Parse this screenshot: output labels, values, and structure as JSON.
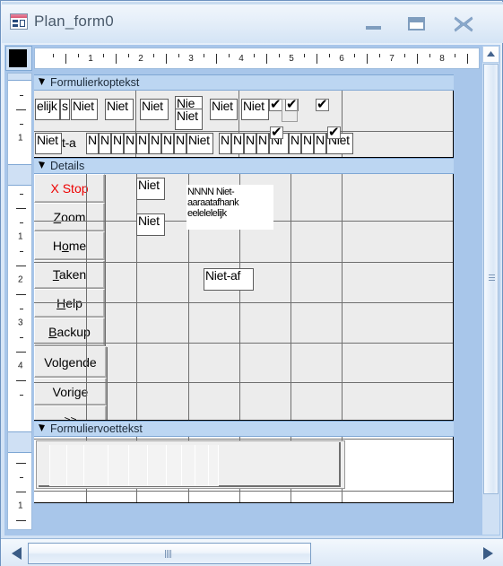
{
  "window": {
    "title": "Plan_form0",
    "icon": "access-form-icon",
    "buttons": {
      "minimize": "minimize-button",
      "maximize": "maximize-button",
      "close": "close-button"
    }
  },
  "rulers": {
    "horizontal_labels": [
      "1",
      "2",
      "3",
      "4",
      "5",
      "6",
      "7",
      "8"
    ],
    "vertical_labels": [
      "1",
      "1",
      "2",
      "3",
      "4"
    ],
    "unit": "inch",
    "select_all_box": "select-all-box"
  },
  "sections": [
    {
      "name": "form-header",
      "label": "Formulierkoptekst"
    },
    {
      "name": "detail",
      "label": "Details"
    },
    {
      "name": "form-footer",
      "label": "Formuliervoettekst"
    }
  ],
  "header_controls": {
    "row1": [
      {
        "type": "textbox",
        "value": "elijk"
      },
      {
        "type": "textbox",
        "value": "s"
      },
      {
        "type": "textbox",
        "value": "Niet"
      },
      {
        "type": "textbox",
        "value": "Niet"
      },
      {
        "type": "textbox",
        "value": "Niet"
      },
      {
        "type": "textbox",
        "value": "Nie"
      },
      {
        "type": "textbox",
        "value": "Niet"
      },
      {
        "type": "textbox",
        "value": "Niet"
      },
      {
        "type": "textbox",
        "value": "Niet"
      },
      {
        "type": "checkbox",
        "checked": true
      },
      {
        "type": "checkbox",
        "checked": true
      },
      {
        "type": "checkbox",
        "checked": true
      }
    ],
    "row2": [
      {
        "type": "textbox",
        "value": "Niet"
      },
      {
        "type": "textbox",
        "value": "t-a"
      },
      {
        "type": "textbox",
        "value": "N"
      },
      {
        "type": "textbox",
        "value": "N"
      },
      {
        "type": "textbox",
        "value": "N"
      },
      {
        "type": "textbox",
        "value": "N"
      },
      {
        "type": "textbox",
        "value": "N"
      },
      {
        "type": "textbox",
        "value": "N"
      },
      {
        "type": "textbox",
        "value": "N"
      },
      {
        "type": "textbox",
        "value": "N"
      },
      {
        "type": "textbox",
        "value": "Niet"
      },
      {
        "type": "textbox",
        "value": "N"
      },
      {
        "type": "textbox",
        "value": "N"
      },
      {
        "type": "textbox",
        "value": "N"
      },
      {
        "type": "textbox",
        "value": "N"
      },
      {
        "type": "textbox",
        "value": "Ni"
      },
      {
        "type": "textbox",
        "value": "N"
      },
      {
        "type": "textbox",
        "value": "N"
      },
      {
        "type": "textbox",
        "value": "N"
      },
      {
        "type": "textbox",
        "value": "Niet"
      },
      {
        "type": "checkbox",
        "checked": true
      },
      {
        "type": "checkbox",
        "checked": true
      }
    ]
  },
  "detail_controls": {
    "buttons_left": [
      {
        "name": "stop-button",
        "label": "X Stop",
        "accel": "",
        "style": "red"
      },
      {
        "name": "zoom-button",
        "label": "Zoom",
        "accel": "Z"
      },
      {
        "name": "home-button",
        "label": "Home",
        "accel": "o"
      },
      {
        "name": "taken-button",
        "label": "Taken",
        "accel": "T"
      },
      {
        "name": "help-button",
        "label": "Help",
        "accel": "H"
      },
      {
        "name": "backup-button",
        "label": "Backup",
        "accel": "B"
      }
    ],
    "buttons_mid": [
      {
        "name": "volgende-button",
        "label": "Volgende"
      },
      {
        "name": "vorige-button",
        "label": "Vorige"
      },
      {
        "name": "forward-button",
        "label": ">>"
      }
    ],
    "textboxes": [
      {
        "name": "detail-textbox-1",
        "value": "Niet"
      },
      {
        "name": "detail-textbox-2",
        "value": "Niet"
      },
      {
        "name": "detail-textbox-3",
        "value": "Niet-af"
      }
    ],
    "memo_label": {
      "name": "memo-label",
      "lines": [
        "NNNN Niet-",
        "aaraatafhank",
        "eelelelelijk"
      ]
    }
  },
  "footer_controls": {
    "chart_subform": {
      "name": "chart-subform",
      "bars": 10
    }
  },
  "scrollbars": {
    "vertical": "vertical-scrollbar",
    "horizontal": "horizontal-scrollbar",
    "up_arrow": "scroll-up-arrow",
    "left_arrow": "scroll-left-arrow",
    "right_arrow": "scroll-right-arrow"
  },
  "colors": {
    "accent": "#a8c6ea",
    "section_bar": "#bcd6f2",
    "canvas": "#ececec",
    "stop_red": "#ee0000",
    "grid_line": "#6f6f6f"
  }
}
